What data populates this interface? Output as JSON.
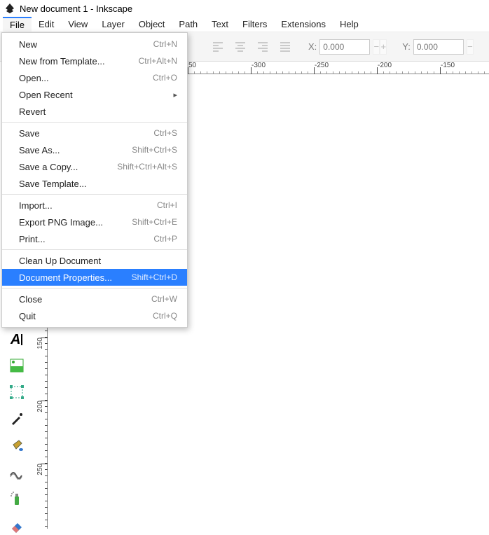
{
  "titlebar": {
    "title": "New document 1 - Inkscape"
  },
  "menubar": {
    "items": [
      "File",
      "Edit",
      "View",
      "Layer",
      "Object",
      "Path",
      "Text",
      "Filters",
      "Extensions",
      "Help"
    ],
    "active": "File"
  },
  "tooloptions": {
    "x_label": "X:",
    "x_value": "0.000",
    "y_label": "Y:",
    "y_value": "0.000"
  },
  "ruler_h": {
    "labels": [
      {
        "pos": 0,
        "text": "50"
      },
      {
        "pos": 90,
        "text": "-300"
      },
      {
        "pos": 180,
        "text": "-250"
      },
      {
        "pos": 270,
        "text": "-200"
      },
      {
        "pos": 360,
        "text": "-150"
      }
    ]
  },
  "ruler_v": {
    "labels": [
      {
        "pos": 376,
        "text": "150"
      },
      {
        "pos": 466,
        "text": "200"
      },
      {
        "pos": 556,
        "text": "250"
      }
    ]
  },
  "file_menu": {
    "groups": [
      [
        {
          "label": "New",
          "shortcut": "Ctrl+N"
        },
        {
          "label": "New from Template...",
          "shortcut": "Ctrl+Alt+N"
        },
        {
          "label": "Open...",
          "shortcut": "Ctrl+O"
        },
        {
          "label": "Open Recent",
          "shortcut": "",
          "submenu": true
        },
        {
          "label": "Revert",
          "shortcut": ""
        }
      ],
      [
        {
          "label": "Save",
          "shortcut": "Ctrl+S"
        },
        {
          "label": "Save As...",
          "shortcut": "Shift+Ctrl+S"
        },
        {
          "label": "Save a Copy...",
          "shortcut": "Shift+Ctrl+Alt+S"
        },
        {
          "label": "Save Template...",
          "shortcut": ""
        }
      ],
      [
        {
          "label": "Import...",
          "shortcut": "Ctrl+I"
        },
        {
          "label": "Export PNG Image...",
          "shortcut": "Shift+Ctrl+E"
        },
        {
          "label": "Print...",
          "shortcut": "Ctrl+P"
        }
      ],
      [
        {
          "label": "Clean Up Document",
          "shortcut": ""
        },
        {
          "label": "Document Properties...",
          "shortcut": "Shift+Ctrl+D",
          "highlight": true
        }
      ],
      [
        {
          "label": "Close",
          "shortcut": "Ctrl+W"
        },
        {
          "label": "Quit",
          "shortcut": "Ctrl+Q"
        }
      ]
    ]
  },
  "toolbox": {
    "tools": [
      "calligraphy-tool",
      "text-tool",
      "gradient-tool",
      "node-tool",
      "dropper-tool",
      "paint-bucket-tool",
      "tweak-tool",
      "spray-tool",
      "eraser-tool"
    ]
  }
}
